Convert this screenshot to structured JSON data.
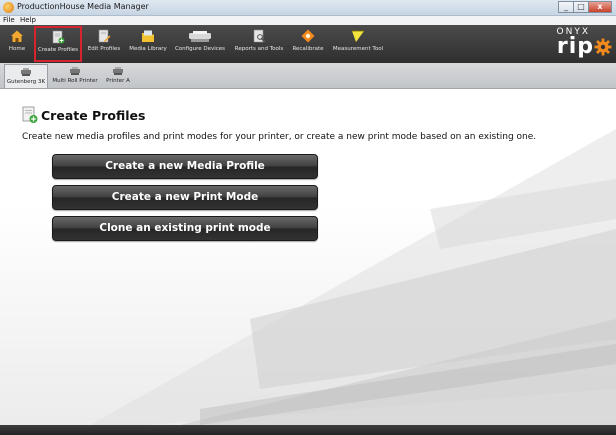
{
  "window": {
    "title": "ProductionHouse Media Manager",
    "minimize": "_",
    "maximize": "□",
    "close": "x"
  },
  "menu": {
    "items": [
      "File",
      "Help"
    ]
  },
  "toolbar": {
    "items": [
      {
        "label": "Home",
        "icon": "home-icon"
      },
      {
        "label": "Create Profiles",
        "icon": "create-profiles-icon",
        "active": true
      },
      {
        "label": "Edit Profiles",
        "icon": "edit-profiles-icon"
      },
      {
        "label": "Media Library",
        "icon": "media-library-icon"
      },
      {
        "label": "Configure Devices",
        "icon": "printer-icon"
      },
      {
        "label": "Reports and Tools",
        "icon": "reports-icon"
      },
      {
        "label": "Recalibrate",
        "icon": "recalibrate-icon"
      },
      {
        "label": "Measurement Tool",
        "icon": "measurement-icon"
      }
    ],
    "brand_top": "ONYX",
    "brand_main": "rip"
  },
  "printers": {
    "items": [
      {
        "label": "Gutenberg 3K",
        "active": true
      },
      {
        "label": "Multi Roll Printer"
      },
      {
        "label": "Printer A"
      }
    ]
  },
  "page": {
    "title": "Create Profiles",
    "description": "Create new media profiles and print modes for your printer, or create a new print mode based on an existing one.",
    "buttons": {
      "new_media_profile": "Create a new Media Profile",
      "new_print_mode": "Create a new Print Mode",
      "clone_print_mode": "Clone an existing print mode"
    }
  },
  "colors": {
    "accent": "#d6242e",
    "toolbar": "#3a3a3a",
    "orange": "#f08a1c"
  }
}
